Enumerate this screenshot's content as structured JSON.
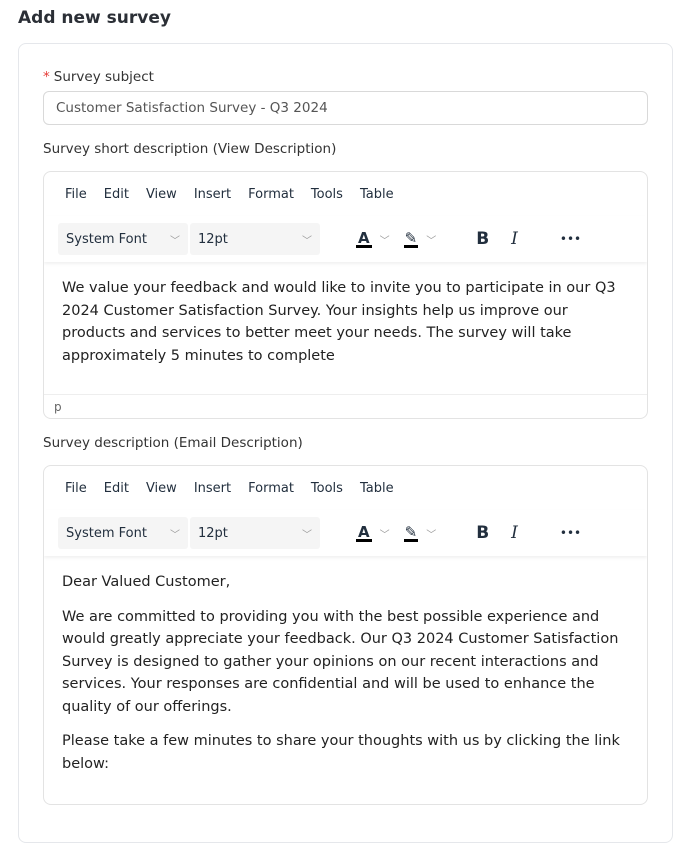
{
  "page": {
    "title": "Add new survey"
  },
  "subject": {
    "required_mark": "*",
    "label": "Survey subject",
    "value": "Customer Satisfaction Survey - Q3 2024"
  },
  "short_desc": {
    "label": "Survey short description (View Description)"
  },
  "email_desc": {
    "label": "Survey description (Email Description)"
  },
  "editor": {
    "menu": [
      "File",
      "Edit",
      "View",
      "Insert",
      "Format",
      "Tools",
      "Table"
    ],
    "font": "System Font",
    "size": "12pt",
    "bold": "B",
    "italic": "I",
    "more": "•••",
    "text_color": "A"
  },
  "editor1": {
    "content": [
      "We value your feedback and would like to invite you to participate in our Q3 2024 Customer Satisfaction Survey. Your insights help us improve our products and services to better meet your needs. The survey will take approximately 5 minutes to complete"
    ],
    "status": "p"
  },
  "editor2": {
    "content": [
      "Dear Valued Customer,",
      "We are committed to providing you with the best possible experience and would greatly appreciate your feedback. Our Q3 2024 Customer Satisfaction Survey is designed to gather your opinions on our recent interactions and services. Your responses are confidential and will be used to enhance the quality of our offerings.",
      "Please take a few minutes to share your thoughts with us by clicking the link below:"
    ]
  }
}
